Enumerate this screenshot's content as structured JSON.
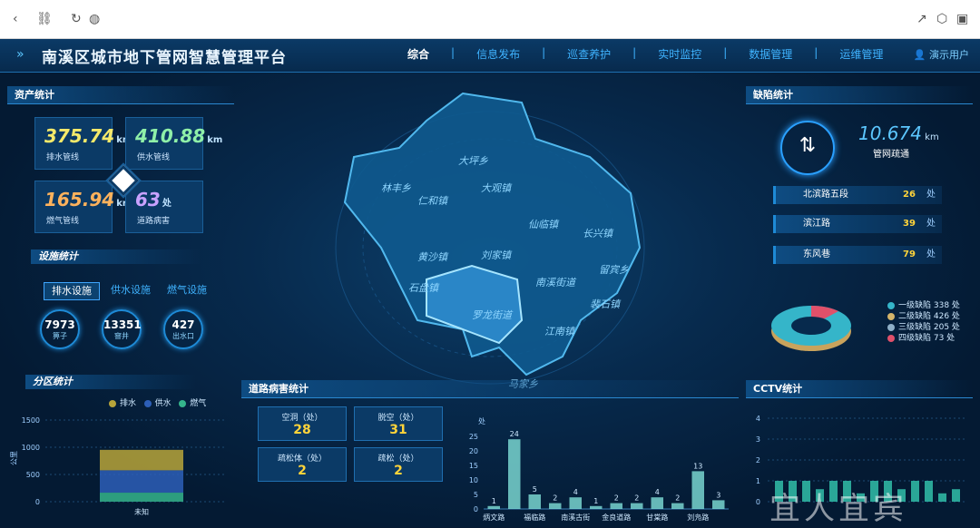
{
  "browser": {
    "icons": [
      "back-icon",
      "link-icon",
      "reload-icon",
      "globe-icon",
      "share-icon",
      "cube-icon",
      "panel-icon"
    ]
  },
  "header": {
    "title": "南溪区城市地下管网智慧管理平台",
    "nav": [
      "综合",
      "信息发布",
      "巡查养护",
      "实时监控",
      "数据管理",
      "运维管理"
    ],
    "active_nav": "综合",
    "user": "演示用户"
  },
  "assets": {
    "title": "资产统计",
    "stats": [
      {
        "value": "375.74",
        "unit": "km",
        "label": "排水管线",
        "color": "#f5e96a"
      },
      {
        "value": "410.88",
        "unit": "km",
        "label": "供水管线",
        "color": "#8ff0a8"
      },
      {
        "value": "165.94",
        "unit": "km",
        "label": "燃气管线",
        "color": "#ffb25c"
      },
      {
        "value": "63",
        "unit": "处",
        "label": "道路病害",
        "color": "#c9a2ff"
      }
    ]
  },
  "facilities": {
    "title": "设施统计",
    "tabs": [
      "排水设施",
      "供水设施",
      "燃气设施"
    ],
    "rings": [
      {
        "value": "7973",
        "label": "箅子"
      },
      {
        "value": "13351",
        "label": "窨井"
      },
      {
        "value": "427",
        "label": "出水口"
      }
    ]
  },
  "district": {
    "title": "分区统计",
    "legend": [
      {
        "name": "排水",
        "color": "#b7a43a"
      },
      {
        "name": "供水",
        "color": "#2d5fb8"
      },
      {
        "name": "燃气",
        "color": "#35b58c"
      }
    ],
    "yunit": "公里",
    "category": "未知"
  },
  "center_map": {
    "regions": [
      "大坪乡",
      "大观镇",
      "林丰乡",
      "仁和镇",
      "仙临镇",
      "长兴镇",
      "黄沙镇",
      "刘家镇",
      "留宾乡",
      "石盘镇",
      "南溪街道",
      "裴石镇",
      "罗龙街道",
      "江南镇",
      "马家乡"
    ]
  },
  "disease": {
    "title": "道路病害统计",
    "cards": [
      {
        "label": "空洞（处）",
        "value": "28"
      },
      {
        "label": "脱空（处）",
        "value": "31"
      },
      {
        "label": "疏松体（处）",
        "value": "2"
      },
      {
        "label": "疏松（处）",
        "value": "2"
      }
    ],
    "yunit": "处",
    "x_labels": [
      "炳文路",
      "福临路",
      "南溪古街",
      "金良道路",
      "甘棠路",
      "刘凫路"
    ]
  },
  "defects": {
    "title": "缺陷统计",
    "main_value": "10.674",
    "main_unit": "km",
    "main_label": "管网疏通",
    "roads": [
      {
        "name": "北滨路五段",
        "count": "26",
        "unit": "处"
      },
      {
        "name": "滨江路",
        "count": "39",
        "unit": "处"
      },
      {
        "name": "东风巷",
        "count": "79",
        "unit": "处"
      }
    ],
    "legend": [
      {
        "label": "一级缺陷 338 处",
        "color": "#35b5c9"
      },
      {
        "label": "二级缺陷 426 处",
        "color": "#d4b46a"
      },
      {
        "label": "三级缺陷 205 处",
        "color": "#8fb0c8"
      },
      {
        "label": "四级缺陷 73 处",
        "color": "#e0506a"
      }
    ]
  },
  "cctv": {
    "title": "CCTV统计",
    "watermark": "宜人宜宾"
  },
  "chart_data": [
    {
      "type": "bar",
      "title": "分区统计",
      "categories": [
        "未知"
      ],
      "series": [
        {
          "name": "排水",
          "values": [
            375.74
          ]
        },
        {
          "name": "供水",
          "values": [
            410.88
          ]
        },
        {
          "name": "燃气",
          "values": [
            165.94
          ]
        }
      ],
      "stacked": true,
      "ylabel": "公里",
      "ylim": [
        0,
        1500
      ],
      "yticks": [
        0,
        500,
        1000,
        1500
      ]
    },
    {
      "type": "bar",
      "title": "道路病害统计",
      "values": [
        1,
        24,
        5,
        2,
        4,
        1,
        2,
        2,
        4,
        2,
        13,
        3
      ],
      "labels": [
        "炳文路",
        "",
        "福临路",
        "",
        "南溪古街",
        "",
        "金良道路",
        "",
        "甘棠路",
        "",
        "刘凫路",
        ""
      ],
      "ylabel": "处",
      "ylim": [
        0,
        25
      ],
      "yticks": [
        0,
        5,
        10,
        15,
        20,
        25
      ]
    },
    {
      "type": "bar",
      "title": "CCTV统计",
      "ylim": [
        0,
        4
      ],
      "yticks": [
        0,
        1,
        2,
        3,
        4
      ]
    }
  ]
}
